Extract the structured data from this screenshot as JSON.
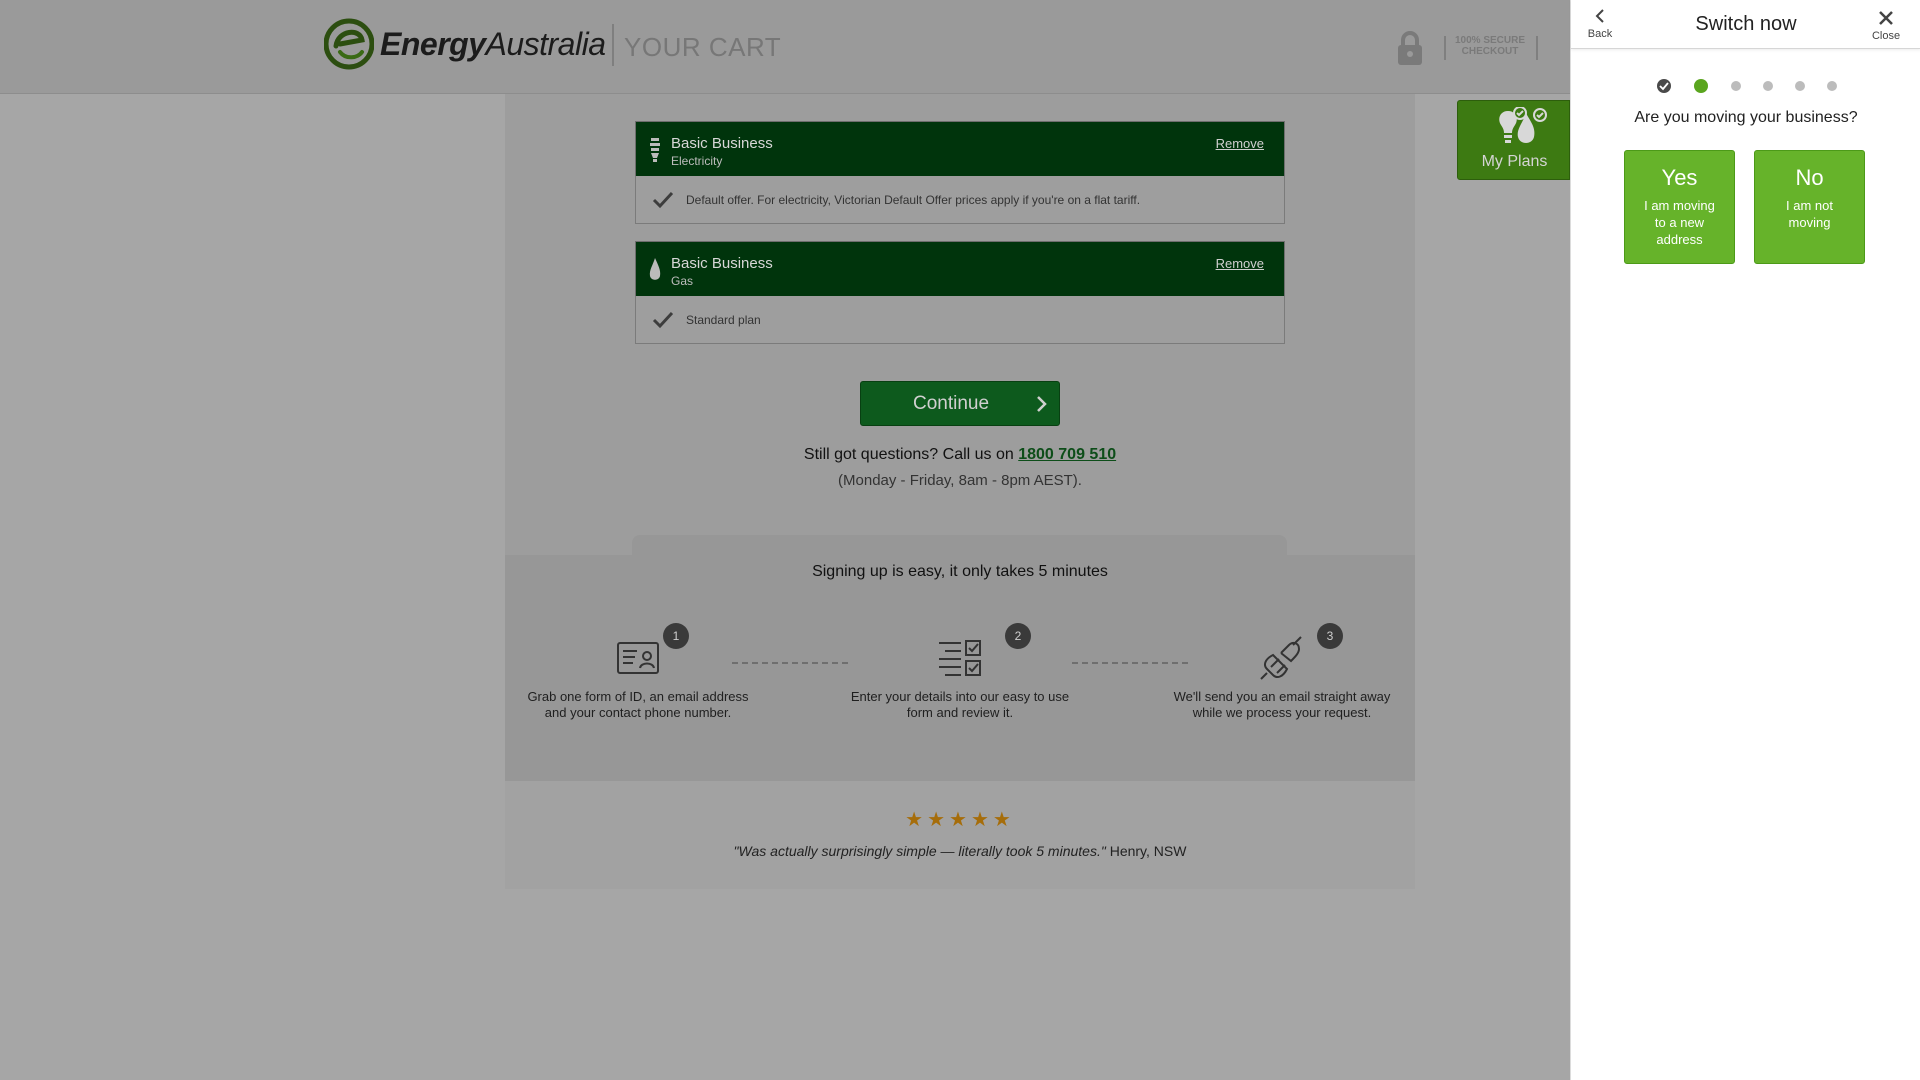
{
  "header": {
    "logo_bold": "Energy",
    "logo_light": "Australia",
    "cart_title": "YOUR CART",
    "secure_line1": "100% SECURE",
    "secure_line2": "CHECKOUT"
  },
  "plans": [
    {
      "name": "Basic Business",
      "type": "Electricity",
      "remove_label": "Remove",
      "description": "Default offer. For electricity, Victorian Default Offer prices apply if you're on a flat tariff.",
      "icon": "electricity-bulb-icon"
    },
    {
      "name": "Basic Business",
      "type": "Gas",
      "remove_label": "Remove",
      "description": "Standard plan",
      "icon": "gas-flame-icon"
    }
  ],
  "continue_label": "Continue",
  "questions": {
    "prefix": "Still got questions? Call us on ",
    "phone": "1800 709 510",
    "hours": "(Monday - Friday, 8am - 8pm AEST)."
  },
  "steps": {
    "title": "Signing up is easy, it only takes 5 minutes",
    "items": [
      {
        "num": "1",
        "text": "Grab one form of ID, an email address and your contact phone number.",
        "icon": "id-card-icon"
      },
      {
        "num": "2",
        "text": "Enter your details into our easy to use form and review it.",
        "icon": "checklist-icon"
      },
      {
        "num": "3",
        "text": "We'll send you an email straight away while we process your request.",
        "icon": "plug-icon"
      }
    ]
  },
  "review": {
    "stars": "★★★★★",
    "rating": 5,
    "quote": "\"Was actually surprisingly simple — literally took 5 minutes.\"",
    "author": " Henry, NSW"
  },
  "my_plans": {
    "label": "My Plans"
  },
  "panel": {
    "back_label": "Back",
    "title": "Switch now",
    "close_label": "Close",
    "progress": {
      "total_steps": 6,
      "completed": 1,
      "current": 2
    },
    "question": "Are you moving your business?",
    "options": [
      {
        "title": "Yes",
        "subtitle": "I am moving to a new address"
      },
      {
        "title": "No",
        "subtitle": "I am not moving"
      }
    ]
  },
  "colors": {
    "brand_green": "#66b32a",
    "plan_header": "#00340c",
    "continue_green": "#0d5a1d",
    "star": "#a66d0a"
  }
}
